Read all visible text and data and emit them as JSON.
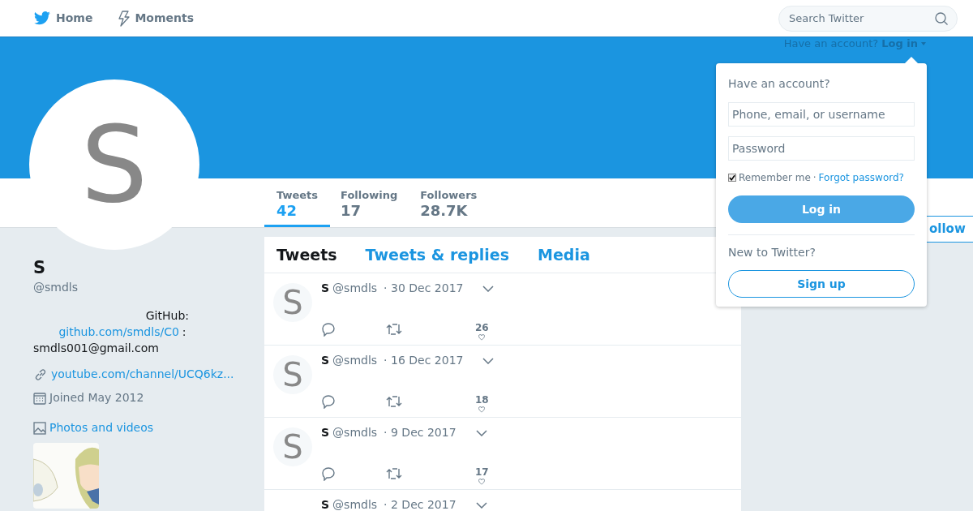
{
  "nav": {
    "items": [
      {
        "label": "Home",
        "kind": "bird"
      },
      {
        "label": "Moments",
        "kind": "bolt"
      }
    ],
    "search": {
      "placeholder": "Search Twitter"
    }
  },
  "login_hint": {
    "text": "Have an account?",
    "link": "Log in"
  },
  "profile": {
    "avatar_letter": "S",
    "name": "S",
    "handle": "@smdls",
    "bio_1": "GitHub:",
    "bio_link": "github.com/smdls/C0",
    "bio_2": ":",
    "bio_3": "smdls001@gmail.com",
    "url": "youtube.com/channel/UCQ6kz...",
    "joined": "Joined May 2012",
    "photos": "Photos and videos"
  },
  "stats": [
    {
      "label": "Tweets",
      "value": "42",
      "selected": true
    },
    {
      "label": "Following",
      "value": "17",
      "selected": false
    },
    {
      "label": "Followers",
      "value": "28.7K",
      "selected": false
    }
  ],
  "follow_button": "ollow",
  "tabs": [
    {
      "label": "Tweets",
      "selected": true
    },
    {
      "label": "Tweets & replies",
      "selected": false
    },
    {
      "label": "Media",
      "selected": false
    }
  ],
  "tweets": [
    {
      "avatar": "S",
      "name": "S",
      "handle": "@smdls",
      "date": "· 30 Dec 2017",
      "likes": "26"
    },
    {
      "avatar": "S",
      "name": "S",
      "handle": "@smdls",
      "date": "· 16 Dec 2017",
      "likes": "18"
    },
    {
      "avatar": "S",
      "name": "S",
      "handle": "@smdls",
      "date": "· 9 Dec 2017",
      "likes": "17"
    },
    {
      "name": "S",
      "handle": "@smdls",
      "date": "· 2 Dec 2017"
    }
  ],
  "login_dropdown": {
    "title": "Have an account?",
    "username_placeholder": "Phone, email, or username",
    "password_placeholder": "Password",
    "remember": "Remember me",
    "remember_checked": true,
    "separator": "·",
    "forgot": "Forgot password?",
    "login_button": "Log in",
    "new_title": "New to Twitter?",
    "signup_button": "Sign up"
  }
}
